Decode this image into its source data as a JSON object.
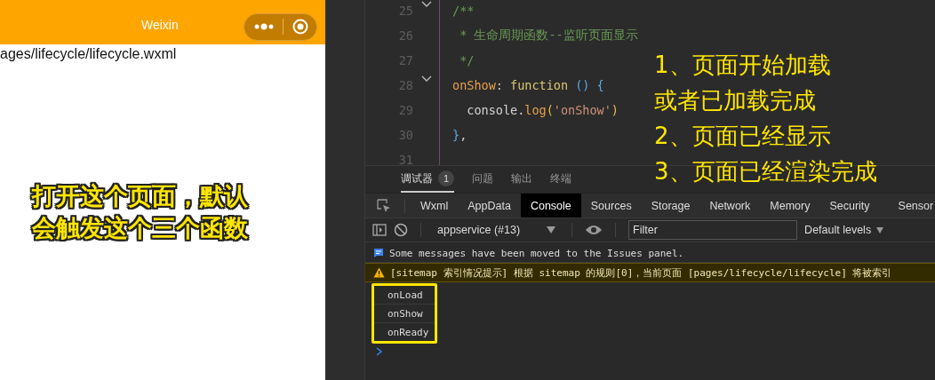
{
  "simulator": {
    "nav_title": "Weixin",
    "page_path": "ages/lifecycle/lifecycle.wxml"
  },
  "editor": {
    "lines": [
      {
        "number": "25",
        "foldable": true,
        "tokens": [
          {
            "kind": "comment",
            "text": "/**"
          }
        ]
      },
      {
        "number": "26",
        "foldable": false,
        "tokens": [
          {
            "kind": "comment",
            "text": " * 生命周期函数--监听页面显示"
          }
        ]
      },
      {
        "number": "27",
        "foldable": false,
        "tokens": [
          {
            "kind": "comment",
            "text": " */"
          }
        ]
      },
      {
        "number": "28",
        "foldable": true,
        "tokens": [
          {
            "kind": "key",
            "text": "onShow"
          },
          {
            "kind": "punct",
            "text": ": "
          },
          {
            "kind": "keyword",
            "text": "function"
          },
          {
            "kind": "bracket",
            "text": " () {"
          }
        ]
      },
      {
        "number": "29",
        "foldable": false,
        "tokens": [
          {
            "kind": "plain",
            "text": "  console."
          },
          {
            "kind": "func",
            "text": "log"
          },
          {
            "kind": "paren",
            "text": "("
          },
          {
            "kind": "string",
            "text": "'onShow'"
          },
          {
            "kind": "paren",
            "text": ")"
          }
        ]
      },
      {
        "number": "30",
        "foldable": false,
        "tokens": [
          {
            "kind": "bracket",
            "text": "}"
          },
          {
            "kind": "plain",
            "text": ","
          }
        ]
      },
      {
        "number": "31",
        "foldable": false
      }
    ]
  },
  "panel_tabs": [
    {
      "label": "调试器",
      "selected": true,
      "badge": "1"
    },
    {
      "label": "问题",
      "selected": false
    },
    {
      "label": "输出",
      "selected": false
    },
    {
      "label": "终端",
      "selected": false
    }
  ],
  "devtools_tabs": [
    {
      "label": "Wxml",
      "selected": false
    },
    {
      "label": "AppData",
      "selected": false
    },
    {
      "label": "Console",
      "selected": true
    },
    {
      "label": "Sources",
      "selected": false
    },
    {
      "label": "Storage",
      "selected": false
    },
    {
      "label": "Network",
      "selected": false
    },
    {
      "label": "Memory",
      "selected": false
    },
    {
      "label": "Security",
      "selected": false
    },
    {
      "label": "Sensor",
      "selected": false
    }
  ],
  "console_toolbar": {
    "context": "appservice (#13)",
    "filter_placeholder": "Filter",
    "levels": "Default levels"
  },
  "console_messages": [
    {
      "kind": "info",
      "text": "Some messages have been moved to the Issues panel."
    },
    {
      "kind": "warning",
      "text": "[sitemap 索引情况提示] 根据 sitemap 的规则[0]，当前页面 [pages/lifecycle/lifecycle] 将被索引"
    }
  ],
  "highlighted_logs": [
    "onLoad",
    "onShow",
    "onReady"
  ],
  "annotations": {
    "left": [
      "打开这个页面，默认",
      "会触发这个三个函数"
    ],
    "right": [
      "1、页面开始加载",
      "或者已加载完成",
      "2、页面已经显示",
      "3、页面已经渲染完成"
    ]
  }
}
